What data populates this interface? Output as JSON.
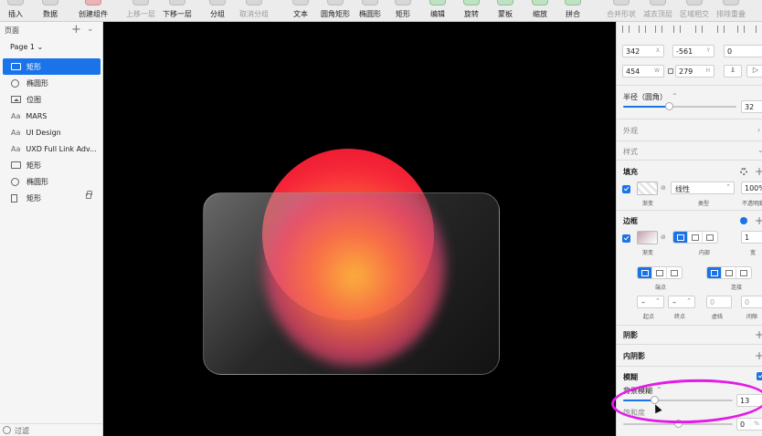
{
  "toolbar": {
    "items": [
      {
        "label": "插入",
        "disabled": false
      },
      {
        "label": "数据",
        "disabled": false
      },
      {
        "label": "创建组件",
        "disabled": false
      },
      {
        "label": "上移一层",
        "disabled": true
      },
      {
        "label": "下移一层",
        "disabled": false
      },
      {
        "label": "分组",
        "disabled": false
      },
      {
        "label": "取消分组",
        "disabled": true
      },
      {
        "label": "文本",
        "disabled": false
      },
      {
        "label": "圆角矩形",
        "disabled": false
      },
      {
        "label": "椭圆形",
        "disabled": false
      },
      {
        "label": "矩形",
        "disabled": false
      },
      {
        "label": "编辑",
        "disabled": false
      },
      {
        "label": "旋转",
        "disabled": false
      },
      {
        "label": "蒙板",
        "disabled": false
      },
      {
        "label": "缩放",
        "disabled": false
      },
      {
        "label": "拼合",
        "disabled": false
      },
      {
        "label": "合并形状",
        "disabled": true
      },
      {
        "label": "减去顶层",
        "disabled": true
      },
      {
        "label": "区域相交",
        "disabled": true
      },
      {
        "label": "排除重叠",
        "disabled": true
      }
    ]
  },
  "sidebar": {
    "title": "页面",
    "page_selector": "Page 1 ⌄",
    "layers": [
      {
        "label": "矩形",
        "icon": "rectangle-icon",
        "selected": true,
        "locked": false
      },
      {
        "label": "椭圆形",
        "icon": "oval-icon",
        "selected": false,
        "locked": false
      },
      {
        "label": "位图",
        "icon": "image-icon",
        "selected": false,
        "locked": false
      },
      {
        "label": "MARS",
        "icon": "text-icon",
        "selected": false,
        "locked": false
      },
      {
        "label": "UI Design",
        "icon": "text-icon",
        "selected": false,
        "locked": false
      },
      {
        "label": "UXD Full Link Adv...",
        "icon": "text-icon",
        "selected": false,
        "locked": false
      },
      {
        "label": "矩形",
        "icon": "rectangle-icon",
        "selected": false,
        "locked": false
      },
      {
        "label": "椭圆形",
        "icon": "oval-icon",
        "selected": false,
        "locked": false
      },
      {
        "label": "矩形",
        "icon": "document-icon",
        "selected": false,
        "locked": true
      }
    ],
    "filter_label": "过滤"
  },
  "inspector": {
    "x": "342",
    "x_unit": "X",
    "y": "-561",
    "y_unit": "Y",
    "rotation": "0",
    "width": "454",
    "width_unit": "W",
    "height": "279",
    "height_unit": "H",
    "radius_label": "半径（圆角）",
    "radius_value": "32",
    "radius_level": 0.4,
    "appearance_label": "外观",
    "style_label": "样式",
    "fill": {
      "title": "填充",
      "type_value": "线性",
      "type_caption": "类型",
      "swatch_caption": "渐变",
      "opacity_value": "100%",
      "opacity_caption": "不透明度"
    },
    "border": {
      "title": "边框",
      "swatch_caption": "渐变",
      "position_caption": "内部",
      "width_value": "1",
      "width_caption": "宽"
    },
    "ends_caption": "端点",
    "joins_caption": "连接",
    "start_value": "–",
    "start_caption": "起点",
    "end_value": "–",
    "end_caption": "终点",
    "dash_value": "0",
    "dash_caption": "虚线",
    "gap_value": "0",
    "gap_caption": "间隙",
    "shadow_label": "阴影",
    "inner_shadow_label": "内阴影",
    "blur_label": "模糊",
    "background_blur_label": "背景模糊",
    "background_blur_value": "13",
    "background_blur_level": 0.28,
    "saturation_label": "饱和度",
    "saturation_value": "0",
    "saturation_unit": "%",
    "saturation_level": 0.5
  },
  "colors": {
    "accent": "#1a73e8",
    "annotation": "#e21ce6",
    "canvas": "#000000",
    "sphere_red": "#f52638",
    "sphere_orange": "#ffb13a"
  }
}
